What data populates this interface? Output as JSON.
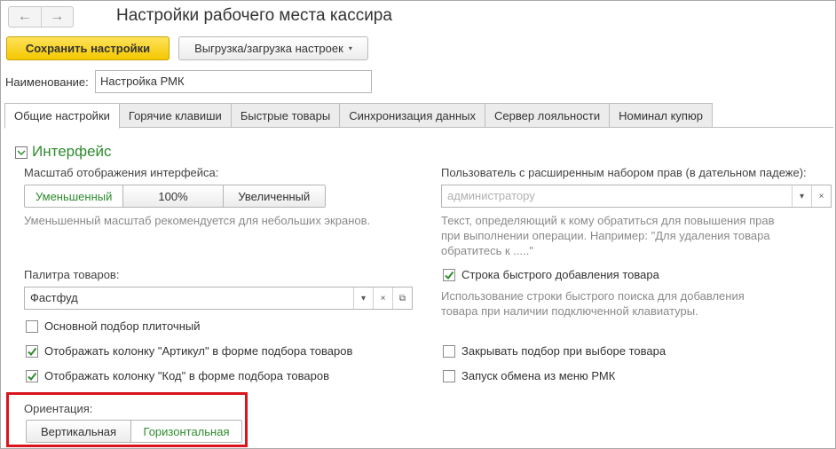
{
  "window": {
    "title": "Настройки рабочего места кассира",
    "back_symbol": "←",
    "forward_symbol": "→"
  },
  "toolbar": {
    "save_label": "Сохранить настройки",
    "export_label": "Выгрузка/загрузка настроек",
    "export_caret": "▾"
  },
  "name_field": {
    "label": "Наименование:",
    "value": "Настройка РМК"
  },
  "tabs": [
    {
      "label": "Общие настройки",
      "active": true
    },
    {
      "label": "Горячие клавиши",
      "active": false
    },
    {
      "label": "Быстрые товары",
      "active": false
    },
    {
      "label": "Синхронизация данных",
      "active": false
    },
    {
      "label": "Сервер лояльности",
      "active": false
    },
    {
      "label": "Номинал купюр",
      "active": false
    }
  ],
  "group": {
    "title": "Интерфейс"
  },
  "scale": {
    "label": "Масштаб отображения интерфейса:",
    "options": [
      "Уменьшенный",
      "100%",
      "Увеличенный"
    ],
    "selected": "Уменьшенный",
    "hint": "Уменьшенный масштаб рекомендуется для небольших экранов."
  },
  "user_rights": {
    "label": "Пользователь с расширенным набором прав (в дательном падеже):",
    "placeholder": "администратору",
    "hint_lines": [
      "Текст, определяющий к кому обратиться для повышения прав",
      "при выполнении операции. Например: \"Для удаления товара",
      "обратитесь к .....\""
    ]
  },
  "palette": {
    "label": "Палитра товаров:",
    "value": "Фастфуд"
  },
  "quick_add": {
    "label": "Строка быстрого добавления товара",
    "checked": true,
    "hint_lines": [
      "Использование строки быстрого поиска для добавления",
      "товара при наличии подключенной клавиатуры."
    ]
  },
  "checkboxes_left": [
    {
      "label": "Основной подбор плиточный",
      "checked": false
    },
    {
      "label": "Отображать колонку \"Артикул\" в форме подбора товаров",
      "checked": true
    },
    {
      "label": "Отображать колонку \"Код\" в форме подбора товаров",
      "checked": true
    }
  ],
  "checkboxes_right": [
    {
      "label": "Закрывать подбор при выборе товара",
      "checked": false
    },
    {
      "label": "Запуск обмена из меню РМК",
      "checked": false
    }
  ],
  "orientation": {
    "label": "Ориентация:",
    "options": [
      "Вертикальная",
      "Горизонтальная"
    ],
    "selected": "Горизонтальная"
  },
  "icons": {
    "dropdown": "▾",
    "clear": "×",
    "open": "⧉"
  },
  "colors": {
    "accent_green": "#2e8b2e",
    "primary_yellow": "#f4c800",
    "highlight_red": "#d9141c",
    "check_green": "#2e8b2e"
  }
}
